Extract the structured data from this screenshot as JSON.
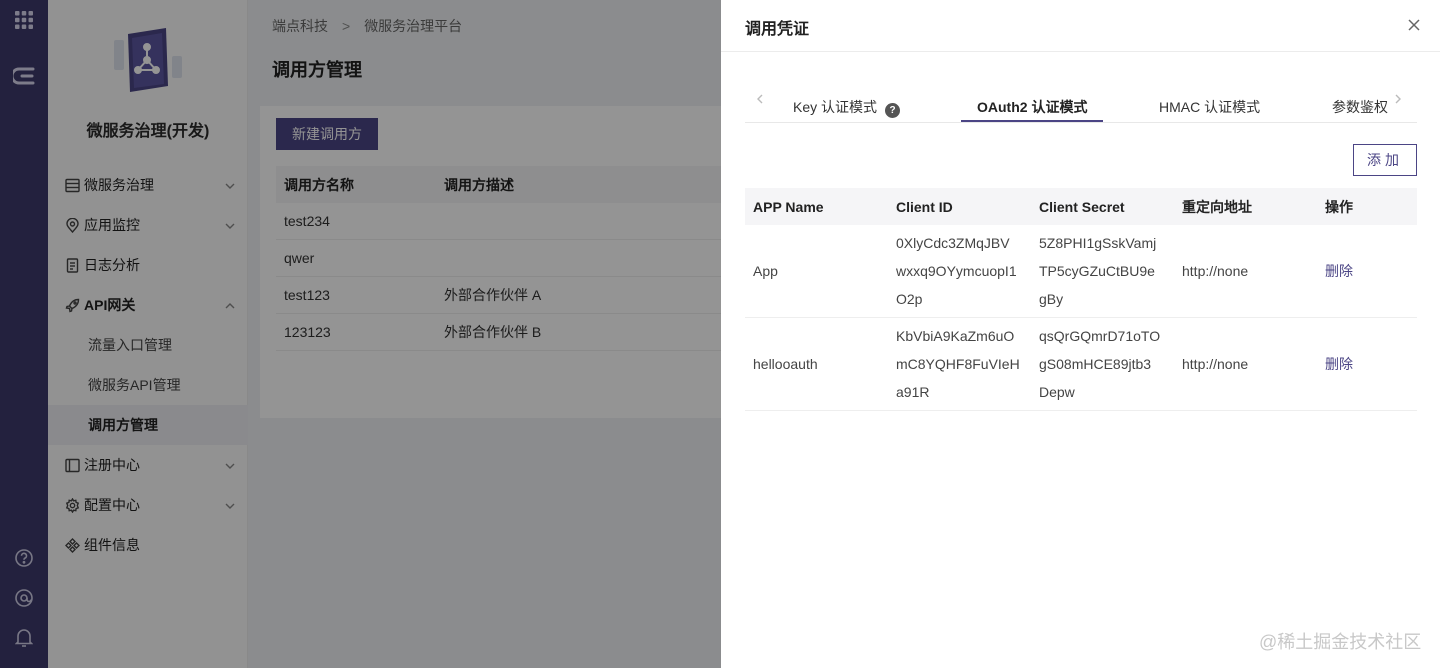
{
  "breadcrumb": {
    "root": "端点科技",
    "sep": ">",
    "current": "微服务治理平台"
  },
  "page": {
    "title": "调用方管理",
    "new_button": "新建调用方"
  },
  "sidebar": {
    "app_title": "微服务治理(开发)",
    "items": [
      {
        "label": "微服务治理",
        "icon": "server-icon",
        "expandable": true
      },
      {
        "label": "应用监控",
        "icon": "location-pin-icon",
        "expandable": true
      },
      {
        "label": "日志分析",
        "icon": "document-icon",
        "expandable": false
      },
      {
        "label": "API网关",
        "icon": "rocket-icon",
        "expandable": true,
        "expanded": true,
        "children": [
          {
            "label": "流量入口管理"
          },
          {
            "label": "微服务API管理"
          },
          {
            "label": "调用方管理",
            "active": true
          }
        ]
      },
      {
        "label": "注册中心",
        "icon": "book-icon",
        "expandable": true
      },
      {
        "label": "配置中心",
        "icon": "gear-icon",
        "expandable": true
      },
      {
        "label": "组件信息",
        "icon": "components-icon",
        "expandable": false
      }
    ]
  },
  "caller_table": {
    "columns": [
      "调用方名称",
      "调用方描述"
    ],
    "rows": [
      {
        "name": "test234",
        "desc": ""
      },
      {
        "name": "qwer",
        "desc": ""
      },
      {
        "name": "test123",
        "desc": "外部合作伙伴 A"
      },
      {
        "name": "123123",
        "desc": "外部合作伙伴 B"
      }
    ]
  },
  "drawer": {
    "title": "调用凭证",
    "tabs": [
      {
        "label": "Key 认证模式",
        "help": "?"
      },
      {
        "label": "OAuth2 认证模式",
        "active": true
      },
      {
        "label": "HMAC 认证模式"
      },
      {
        "label": "参数鉴权"
      }
    ],
    "add_button": "添加",
    "table": {
      "columns": [
        "APP Name",
        "Client ID",
        "Client Secret",
        "重定向地址",
        "操作"
      ],
      "rows": [
        {
          "app": "App",
          "client_id": [
            "0XlyCdc3ZMqJBV",
            "wxxq9OYymcuopI1",
            "O2p"
          ],
          "secret": [
            "5Z8PHI1gSskVamj",
            "TP5cyGZuCtBU9e",
            "gBy"
          ],
          "redirect": "http://none",
          "action": "删除"
        },
        {
          "app": "hellooauth",
          "client_id": [
            "KbVbiA9KaZm6uO",
            "mC8YQHF8FuVIeH",
            "a91R"
          ],
          "secret": [
            "qsQrGQmrD71oTO",
            "gS08mHCE89jtb3",
            "Depw"
          ],
          "redirect": "http://none",
          "action": "删除"
        }
      ]
    }
  },
  "watermark": "@稀土掘金技术社区",
  "colors": {
    "rail": "#3d3a6b",
    "accent": "#4b4585"
  }
}
